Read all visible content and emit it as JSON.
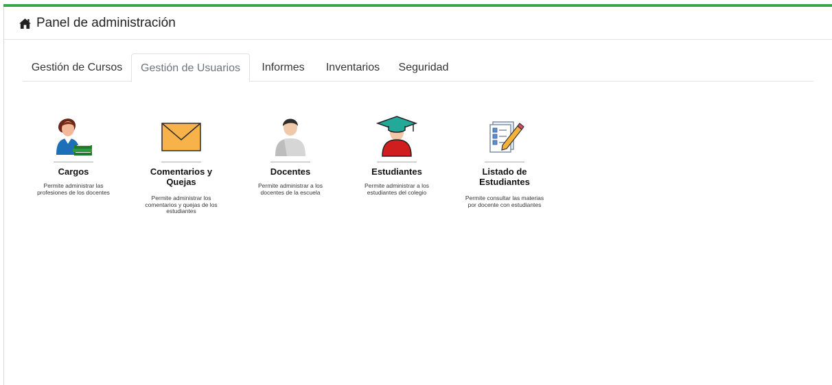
{
  "header": {
    "title": "Panel de administración",
    "icon": "home-icon"
  },
  "colors": {
    "accent": "#3aa64a",
    "envelope": "#f7b349",
    "graduate": "#d01e1e",
    "cap": "#22a99a"
  },
  "tabs": [
    {
      "label": "Gestión de Cursos",
      "active": false
    },
    {
      "label": "Gestión de Usuarios",
      "active": true
    },
    {
      "label": "Informes",
      "active": false
    },
    {
      "label": "Inventarios",
      "active": false
    },
    {
      "label": "Seguridad",
      "active": false
    }
  ],
  "modules": [
    {
      "name": "Cargos",
      "description": "Permite administrar las profesiones de los docentes",
      "icon": "teacher-books-icon"
    },
    {
      "name": "Comentarios y Quejas",
      "description": "Permite administrar los comentarios y quejas de los estudiantes",
      "icon": "envelope-icon"
    },
    {
      "name": "Docentes",
      "description": "Permite administrar a los docentes de la escuela",
      "icon": "user-icon"
    },
    {
      "name": "Estudiantes",
      "description": "Permite administrar a los estudiantes del colegio",
      "icon": "graduate-icon"
    },
    {
      "name": "Listado de Estudiantes",
      "description": "Permite consultar las materias por docente con estudiantes",
      "icon": "checklist-icon"
    }
  ]
}
